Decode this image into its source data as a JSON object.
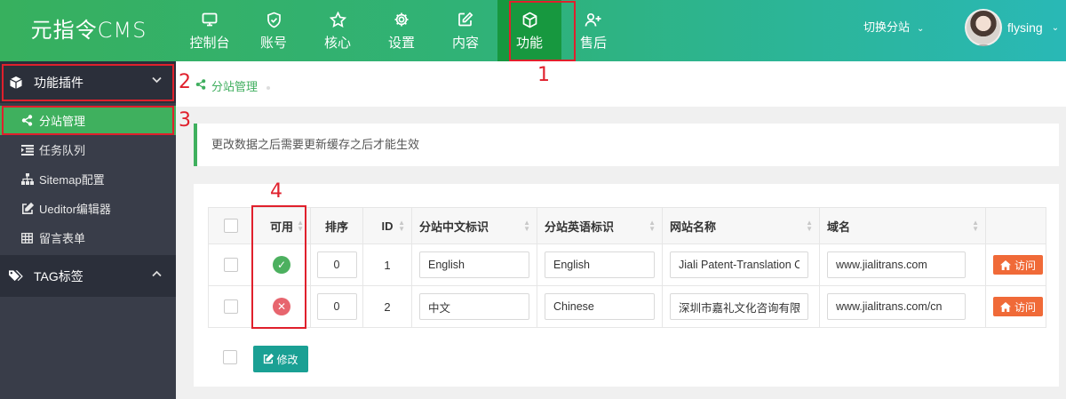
{
  "app": {
    "logo_text": "元指令CMS"
  },
  "nav": {
    "items": [
      {
        "label": "控制台",
        "icon": "monitor-icon"
      },
      {
        "label": "账号",
        "icon": "shield-check-icon"
      },
      {
        "label": "核心",
        "icon": "star-icon"
      },
      {
        "label": "设置",
        "icon": "gear-icon"
      },
      {
        "label": "内容",
        "icon": "edit-icon"
      },
      {
        "label": "功能",
        "icon": "cube-icon",
        "active": true
      },
      {
        "label": "售后",
        "icon": "user-plus-icon"
      }
    ],
    "switch_site": "切换分站",
    "username": "flysing"
  },
  "sidebar": {
    "groups": [
      {
        "label": "功能插件",
        "icon": "cube-icon",
        "expanded": true
      },
      {
        "label": "TAG标签",
        "icon": "tags-icon",
        "expanded": false
      }
    ],
    "items": [
      {
        "label": "分站管理",
        "icon": "share-icon",
        "active": true
      },
      {
        "label": "任务队列",
        "icon": "list-indent-icon"
      },
      {
        "label": "Sitemap配置",
        "icon": "sitemap-icon"
      },
      {
        "label": "Ueditor编辑器",
        "icon": "edit-box-icon"
      },
      {
        "label": "留言表单",
        "icon": "table-icon"
      }
    ]
  },
  "breadcrumb": {
    "label": "分站管理",
    "icon": "share-icon"
  },
  "notice": {
    "text": "更改数据之后需要更新缓存之后才能生效"
  },
  "table": {
    "columns": [
      "可用",
      "排序",
      "ID",
      "分站中文标识",
      "分站英语标识",
      "网站名称",
      "域名"
    ],
    "rows": [
      {
        "enabled": true,
        "sort": "0",
        "id": "1",
        "name_cn": "English",
        "name_en": "English",
        "site_name": "Jiali Patent-Translation C",
        "domain": "www.jialitrans.com",
        "visit": "访问"
      },
      {
        "enabled": false,
        "sort": "0",
        "id": "2",
        "name_cn": "中文",
        "name_en": "Chinese",
        "site_name": "深圳市嘉礼文化咨询有限公",
        "domain": "www.jialitrans.com/cn",
        "visit": "访问"
      }
    ]
  },
  "actions": {
    "edit_label": "修改"
  },
  "annotations": [
    "1",
    "2",
    "3",
    "4"
  ],
  "colors": {
    "accent_green": "#3fb05e",
    "active_nav": "#17983f",
    "visit_orange": "#f06a38",
    "edit_teal": "#1aa094",
    "annotation_red": "#e0202c"
  }
}
